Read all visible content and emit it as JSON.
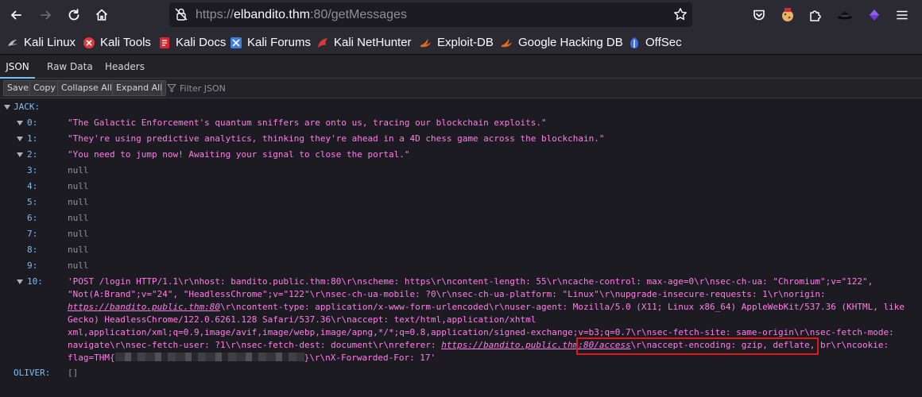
{
  "browser": {
    "url_prefix": "https://",
    "url_host": "elbandito.thm",
    "url_rest": ":80/getMessages"
  },
  "bookmarks": [
    {
      "label": "Kali Linux",
      "icon": "kali-dragon-icon",
      "color": "#b9b9c0"
    },
    {
      "label": "Kali Tools",
      "icon": "kali-tools-icon",
      "color": "#e23a3a"
    },
    {
      "label": "Kali Docs",
      "icon": "kali-docs-icon",
      "color": "#d8272e"
    },
    {
      "label": "Kali Forums",
      "icon": "kali-forums-icon",
      "color": "#3d7fe0"
    },
    {
      "label": "Kali NetHunter",
      "icon": "nethunter-icon",
      "color": "#d73838"
    },
    {
      "label": "Exploit-DB",
      "icon": "exploit-db-icon",
      "color": "#e76a1b"
    },
    {
      "label": "Google Hacking DB",
      "icon": "ghdb-icon",
      "color": "#e76a1b"
    },
    {
      "label": "OffSec",
      "icon": "offsec-icon",
      "color": "#3b6fe0"
    }
  ],
  "devtools": {
    "tabs": [
      "JSON",
      "Raw Data",
      "Headers"
    ],
    "buttons": [
      "Save",
      "Copy",
      "Collapse All",
      "Expand All"
    ],
    "filter_placeholder": "Filter JSON"
  },
  "json": {
    "jack_key": "JACK:",
    "items": [
      {
        "key": "0:",
        "value": "\"The Galactic Enforcement's quantum sniffers are onto us, tracing our blockchain exploits.\"",
        "type": "string"
      },
      {
        "key": "1:",
        "value": "\"They're using predictive analytics, thinking they're ahead in a 4D chess game across the blockchain.\"",
        "type": "string"
      },
      {
        "key": "2:",
        "value": "\"You need to jump now! Awaiting your signal to close the portal.\"",
        "type": "string"
      },
      {
        "key": "3:",
        "value": "null",
        "type": "null"
      },
      {
        "key": "4:",
        "value": "null",
        "type": "null"
      },
      {
        "key": "5:",
        "value": "null",
        "type": "null"
      },
      {
        "key": "6:",
        "value": "null",
        "type": "null"
      },
      {
        "key": "7:",
        "value": "null",
        "type": "null"
      },
      {
        "key": "8:",
        "value": "null",
        "type": "null"
      },
      {
        "key": "9:",
        "value": "null",
        "type": "null"
      }
    ],
    "item10_key": "10:",
    "item10": {
      "t1": "'POST /login HTTP/1.1\\r\\nhost: bandito.public.thm:80\\r\\nscheme: https\\r\\ncontent-length: 55\\r\\ncache-control: max-age=0\\r\\nsec-ch-ua: \"Chromium\";v=\"122\", \"Not(A:Brand\";v=\"24\", \"HeadlessChrome\";v=\"122\"\\r\\nsec-ch-ua-mobile: ?0\\r\\nsec-ch-ua-platform: \"Linux\"\\r\\nupgrade-insecure-requests: 1\\r\\norigin: ",
      "link1": "https://bandito.public.thm:80",
      "t2": "\\r\\ncontent-type: application/x-www-form-urlencoded\\r\\nuser-agent: Mozilla/5.0 (X11; Linux x86_64) AppleWebKit/537.36 (KHTML, like Gecko) HeadlessChrome/122.0.6261.128 Safari/537.36\\r\\naccept: text/html,application/xhtml xml,application/xml;q=0.9,image/avif,image/webp,image/apng,*/*;q=0.8,application/signed-exchange;v=b3;q=0.7\\r\\nsec-fetch-site: same-origin\\r\\nsec-fetch-mode: navigate\\r\\nsec-fetch-user: ?1\\r\\nsec-fetch-dest: document\\r\\nreferer: ",
      "link2": "https://bandito.public.thm:80/access",
      "t3": "\\r\\naccept-encoding: gzip, deflate, br\\r\\ncookie: ",
      "flag_prefix": "flag=THM{",
      "flag_suffix": "}",
      "t4": "\\r\\nX-Forwarded-For: 17'"
    },
    "oliver_key": "OLIVER:",
    "oliver_value": "[]"
  }
}
